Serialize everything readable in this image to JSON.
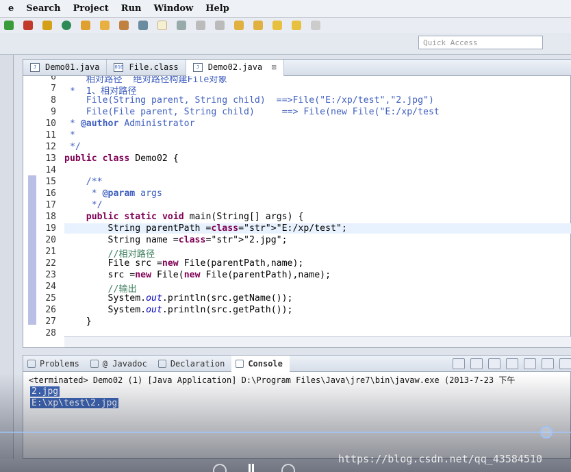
{
  "menu": [
    "e",
    "Search",
    "Project",
    "Run",
    "Window",
    "Help"
  ],
  "quick_access": {
    "placeholder": "Quick Access"
  },
  "editor": {
    "tabs": [
      {
        "label": "Demo01.java",
        "icon": "J",
        "active": false
      },
      {
        "label": "File.class",
        "icon": "010",
        "active": false
      },
      {
        "label": "Demo02.java",
        "icon": "J",
        "active": true,
        "close": "⊠"
      }
    ],
    "line_numbers": [
      "6",
      "7",
      "8",
      "9",
      "10",
      "11",
      "12",
      "13",
      "14",
      "15",
      "16",
      "17",
      "18",
      "19",
      "20",
      "21",
      "22",
      "23",
      "24",
      "25",
      "26",
      "27",
      "28"
    ],
    "lines": [
      "    相对路径  绝对路径构建File对象",
      " *  1、相对路径",
      "    File(String parent, String child)  ==>File(\"E:/xp/test\",\"2.jpg\")",
      "    File(File parent, String child)     ==> File(new File(\"E:/xp/test",
      " * @author Administrator",
      " *",
      " */",
      "public class Demo02 {",
      "",
      "    /**",
      "     * @param args",
      "     */",
      "    public static void main(String[] args) {",
      "        String parentPath =\"E:/xp/test\";",
      "        String name =\"2.jpg\";",
      "        //相对路径",
      "        File src =new File(parentPath,name);",
      "        src =new File(new File(parentPath),name);",
      "        //输出",
      "        System.out.println(src.getName());",
      "        System.out.println(src.getPath());",
      "    }",
      ""
    ]
  },
  "console": {
    "tabs": [
      "Problems",
      "@ Javadoc",
      "Declaration",
      "Console"
    ],
    "active_tab": "Console",
    "status": "<terminated> Demo02 (1) [Java Application] D:\\Program Files\\Java\\jre7\\bin\\javaw.exe (2013-7-23 下午",
    "output": [
      "2.jpg",
      "E:\\xp\\test\\2.jpg"
    ]
  },
  "video": {
    "progress": 0.96
  },
  "watermark": "https://blog.csdn.net/qq_43584510"
}
